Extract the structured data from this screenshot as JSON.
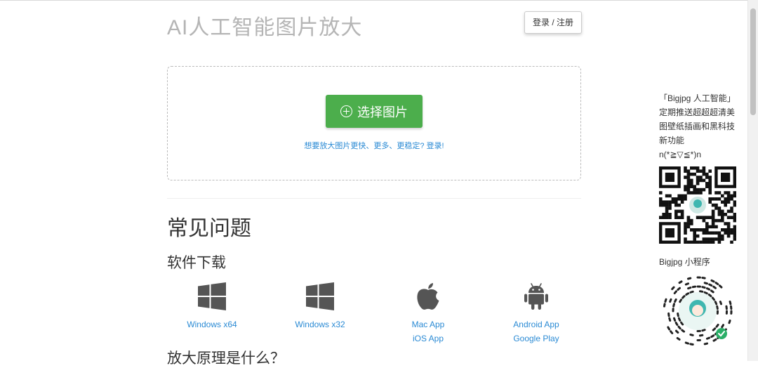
{
  "header": {
    "title": "AI人工智能图片放大",
    "login_label": "登录 / 注册"
  },
  "upload": {
    "select_label": "选择图片",
    "hint": "想要放大图片更快、更多、更稳定? 登录!"
  },
  "faq": {
    "title": "常见问题",
    "download_title": "软件下载",
    "next_title": "放大原理是什么？"
  },
  "downloads": [
    {
      "icon": "windows-icon",
      "links": [
        "Windows x64"
      ]
    },
    {
      "icon": "windows-icon",
      "links": [
        "Windows x32"
      ]
    },
    {
      "icon": "apple-icon",
      "links": [
        "Mac App",
        "iOS App"
      ]
    },
    {
      "icon": "android-icon",
      "links": [
        "Android App",
        "Google Play"
      ]
    }
  ],
  "sidebar": {
    "promo_lines": [
      "「Bigjpg 人工智能」",
      "定期推送超超超清美",
      "图壁纸插画和黑科技",
      "新功能",
      "n(*≧▽≦*)n"
    ],
    "mini_program_label": "Bigjpg 小程序"
  },
  "colors": {
    "primary_green": "#4cae4c",
    "link_blue": "#2a8ad4",
    "title_gray": "#b5b5b5",
    "icon_gray": "#555555"
  }
}
